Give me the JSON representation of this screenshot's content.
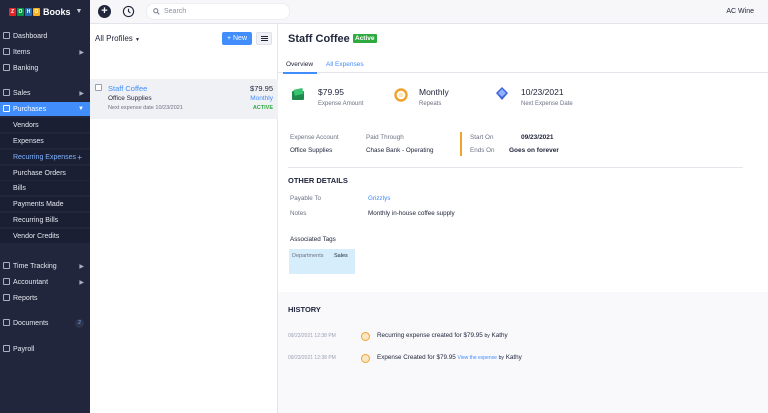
{
  "topbar": {
    "logo_letters": [
      "Z",
      "O",
      "H",
      "O"
    ],
    "logo_colors": [
      "#e42527",
      "#089949",
      "#226db4",
      "#f9b21d"
    ],
    "app_name": "Books",
    "search_placeholder": "Search",
    "org_name": "AC Wine"
  },
  "sidebar": {
    "items": {
      "dashboard": "Dashboard",
      "items": "Items",
      "banking": "Banking",
      "sales": "Sales",
      "purchases": "Purchases",
      "time_tracking": "Time Tracking",
      "accountant": "Accountant",
      "reports": "Reports",
      "documents": "Documents",
      "payroll": "Payroll"
    },
    "documents_count": "2",
    "purchases_sub": {
      "vendors": "Vendors",
      "expenses": "Expenses",
      "recurring_expenses": "Recurring Expenses",
      "purchase_orders": "Purchase Orders",
      "bills": "Bills",
      "payments_made": "Payments Made",
      "recurring_bills": "Recurring Bills",
      "vendor_credits": "Vendor Credits"
    }
  },
  "list": {
    "title": "All Profiles",
    "new_button": "+ New",
    "rows": [
      {
        "name": "Staff Coffee",
        "amount": "$79.95",
        "account": "Office Supplies",
        "frequency": "Monthly",
        "next": "Next expense date 10/23/2021",
        "status": "ACTIVE"
      }
    ]
  },
  "detail": {
    "title": "Staff Coffee",
    "badge": "Active",
    "tabs": [
      "Overview",
      "All Expenses"
    ],
    "summary": [
      {
        "value": "$79.95",
        "label": "Expense Amount",
        "icon": "money-icon"
      },
      {
        "value": "Monthly",
        "label": "Repeats",
        "icon": "repeat-icon"
      },
      {
        "value": "10/23/2021",
        "label": "Next Expense Date",
        "icon": "calendar-icon"
      }
    ],
    "expense_account_label": "Expense Account",
    "expense_account": "Office Supplies",
    "paid_through_label": "Paid Through",
    "paid_through": "Chase Bank - Operating",
    "start_on_label": "Start On",
    "start_on": "09/23/2021",
    "ends_on_label": "Ends On",
    "ends_on": "Goes on forever",
    "other_details_heading": "OTHER DETAILS",
    "payable_to_label": "Payable To",
    "payable_to": "Grizzlys",
    "notes_label": "Notes",
    "notes": "Monthly in-house coffee supply",
    "associated_tags_label": "Associated Tags",
    "tag_key": "Departments",
    "tag_value": "Sales"
  },
  "history": {
    "heading": "HISTORY",
    "entries": [
      {
        "time": "09/23/2021 12:38 PM",
        "text": "Recurring expense created for $79.95",
        "by": "by",
        "user": "Kathy",
        "link": ""
      },
      {
        "time": "09/23/2021 12:38 PM",
        "text": "Expense Created for $79.95",
        "by": "by",
        "user": "Kathy",
        "link": "View the expense"
      }
    ]
  },
  "colors": {
    "sidebar_bg": "#21263c",
    "accent": "#408dfb",
    "active_green": "#2eaa3f",
    "highlight_orange": "#f0a22e"
  }
}
